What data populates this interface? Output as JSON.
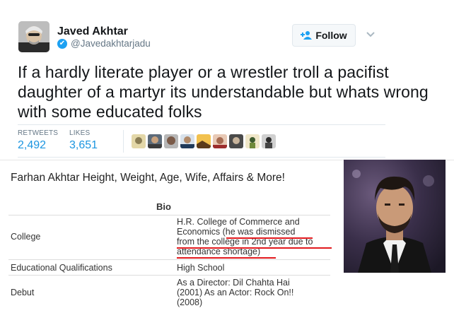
{
  "tweet": {
    "author_name": "Javed Akhtar",
    "author_handle": "@Javedakhtarjadu",
    "verified_glyph": "✔",
    "follow_label": "Follow",
    "text": "If a hardly literate player or a wrestler troll a pacifist daughter of a martyr its understandable but whats wrong with some educated folks",
    "stats": {
      "retweets_label": "RETWEETS",
      "retweets_value": "2,492",
      "likes_label": "LIKES",
      "likes_value": "3,651"
    },
    "liker_avatar_count": 9,
    "accent_color": "#1da1f2",
    "link_color": "#1b95e0"
  },
  "article": {
    "title": "Farhan Akhtar Height, Weight, Age, Wife, Affairs & More!",
    "bio_header": "Bio",
    "rows": [
      {
        "label": "College",
        "value_lines": [
          "H.R. College of Commerce and",
          "Economics (he was dismissed",
          "from the college in 2nd year due to",
          "attendance shortage)"
        ]
      },
      {
        "label": "Educational Qualifications",
        "value_lines": [
          "High School"
        ]
      },
      {
        "label": "Debut",
        "value_lines": [
          "As a Director: Dil Chahta Hai",
          "(2001) As an Actor: Rock On!!",
          "(2008)"
        ]
      }
    ],
    "highlight_color": "#e1191d"
  }
}
